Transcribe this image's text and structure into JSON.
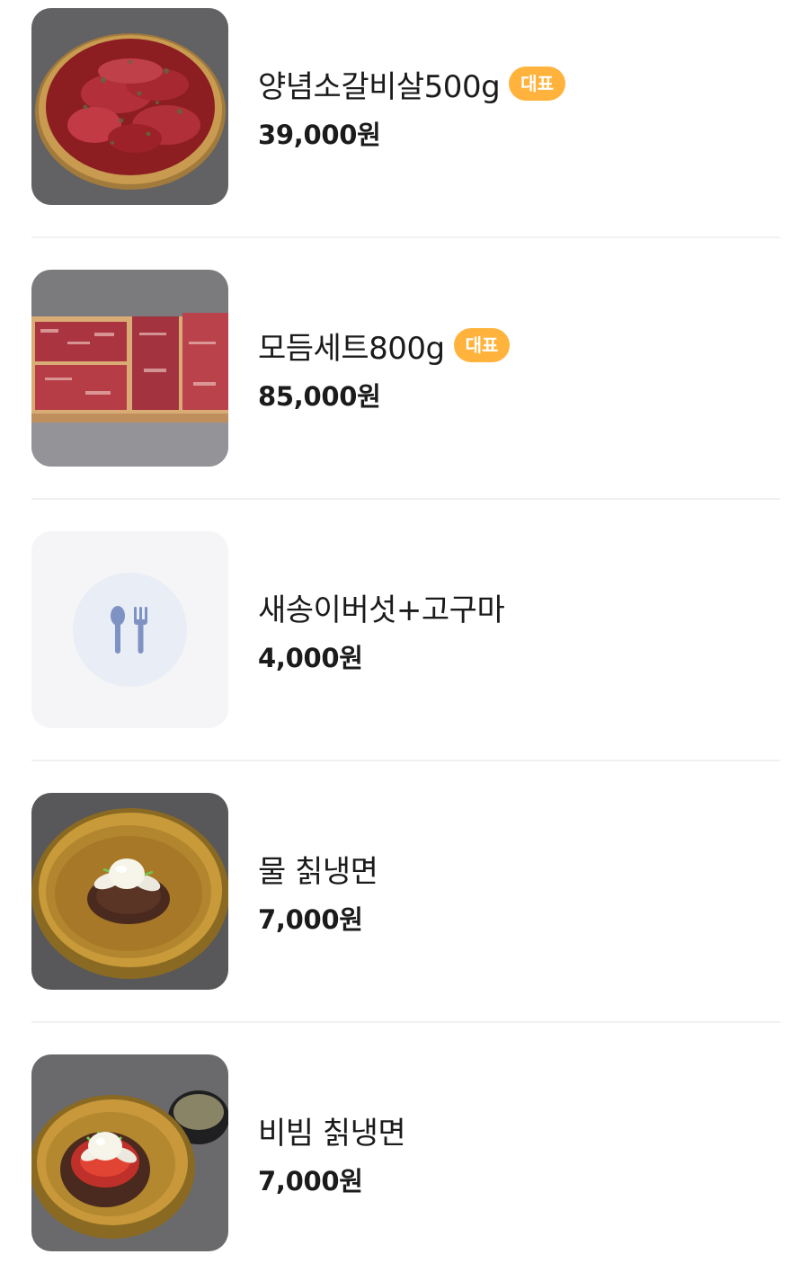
{
  "menu": {
    "items": [
      {
        "name": "양념소갈비살500g",
        "badge": "대표",
        "price": "39,000원",
        "image": "marinated-beef-rib-photo"
      },
      {
        "name": "모듬세트800g",
        "badge": "대표",
        "price": "85,000원",
        "image": "assorted-beef-set-photo"
      },
      {
        "name": "새송이버섯+고구마",
        "price": "4,000원",
        "image": "utensils-placeholder-icon"
      },
      {
        "name": "물 칡냉면",
        "price": "7,000원",
        "image": "cold-arrowroot-noodles-photo"
      },
      {
        "name": "비빔 칡냉면",
        "price": "7,000원",
        "image": "spicy-arrowroot-noodles-photo"
      }
    ]
  },
  "colors": {
    "badge_bg": "#ffb33c",
    "badge_text": "#ffffff",
    "divider": "#f1f1f1",
    "placeholder_bg": "#f5f5f7",
    "placeholder_icon": "#7e92c4"
  }
}
